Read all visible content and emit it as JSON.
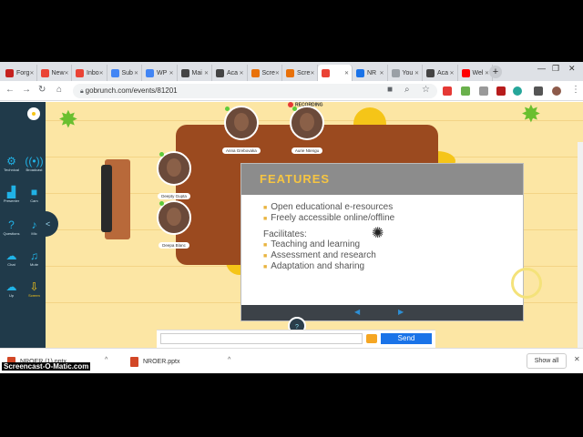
{
  "tabs": [
    {
      "label": "Forg",
      "color": "#c5221f"
    },
    {
      "label": "New",
      "color": "#ea4335"
    },
    {
      "label": "Inbo",
      "color": "#ea4335"
    },
    {
      "label": "Sub",
      "color": "#4285f4"
    },
    {
      "label": "WP",
      "color": "#4285f4"
    },
    {
      "label": "Mai",
      "color": "#444"
    },
    {
      "label": "Aca",
      "color": "#444"
    },
    {
      "label": "Scre",
      "color": "#e8710a"
    },
    {
      "label": "Scre",
      "color": "#e8710a"
    },
    {
      "label": "",
      "color": "#ea4335"
    },
    {
      "label": "NR",
      "color": "#1a73e8"
    },
    {
      "label": "You",
      "color": "#9aa0a6"
    },
    {
      "label": "Aca",
      "color": "#444"
    },
    {
      "label": "Wel",
      "color": "#ff0000"
    }
  ],
  "browser": {
    "url": "gobrunch.com/events/81201",
    "new_tab": "+"
  },
  "sidebar": [
    {
      "label": "Technical",
      "icon": "gear-icon",
      "glyph": "⚙"
    },
    {
      "label": "Broadcast",
      "icon": "broadcast-icon",
      "glyph": "((•))"
    },
    {
      "label": "Presenter",
      "icon": "presenter-icon",
      "glyph": "▟"
    },
    {
      "label": "Cam",
      "icon": "camera-icon",
      "glyph": "■"
    },
    {
      "label": "Questions",
      "icon": "question-icon",
      "glyph": "?"
    },
    {
      "label": "Mic",
      "icon": "mic-icon",
      "glyph": "♪"
    },
    {
      "label": "Chat",
      "icon": "chat-icon",
      "glyph": "☁"
    },
    {
      "label": "Mute",
      "icon": "speaker-icon",
      "glyph": "♫"
    },
    {
      "label": "Up",
      "icon": "upload-icon",
      "glyph": "☁"
    },
    {
      "label": "Screen",
      "icon": "screen-share-icon",
      "glyph": "⇩"
    }
  ],
  "participants": [
    {
      "name": "Anna Grebovaka"
    },
    {
      "name": "Aurie Ntengu"
    },
    {
      "name": "Deepty Gupta"
    },
    {
      "name": "Deepa Blanc"
    }
  ],
  "recording_label": "RECORDING",
  "slide": {
    "title": "FEATURES",
    "bullets_a": [
      "Open educational e-resources",
      "Freely accessible online/offline"
    ],
    "subheading": "Facilitates:",
    "bullets_b": [
      "Teaching and learning",
      "Assessment and research",
      "Adaptation and sharing"
    ]
  },
  "help_label": "?",
  "chat": {
    "input_placeholder": "",
    "send_label": "Send"
  },
  "downloads": [
    {
      "name": "NROER (1).pptx"
    },
    {
      "name": "NROER.pptx"
    }
  ],
  "show_all_label": "Show all",
  "watermark": "Screencast-O-Matic.com"
}
